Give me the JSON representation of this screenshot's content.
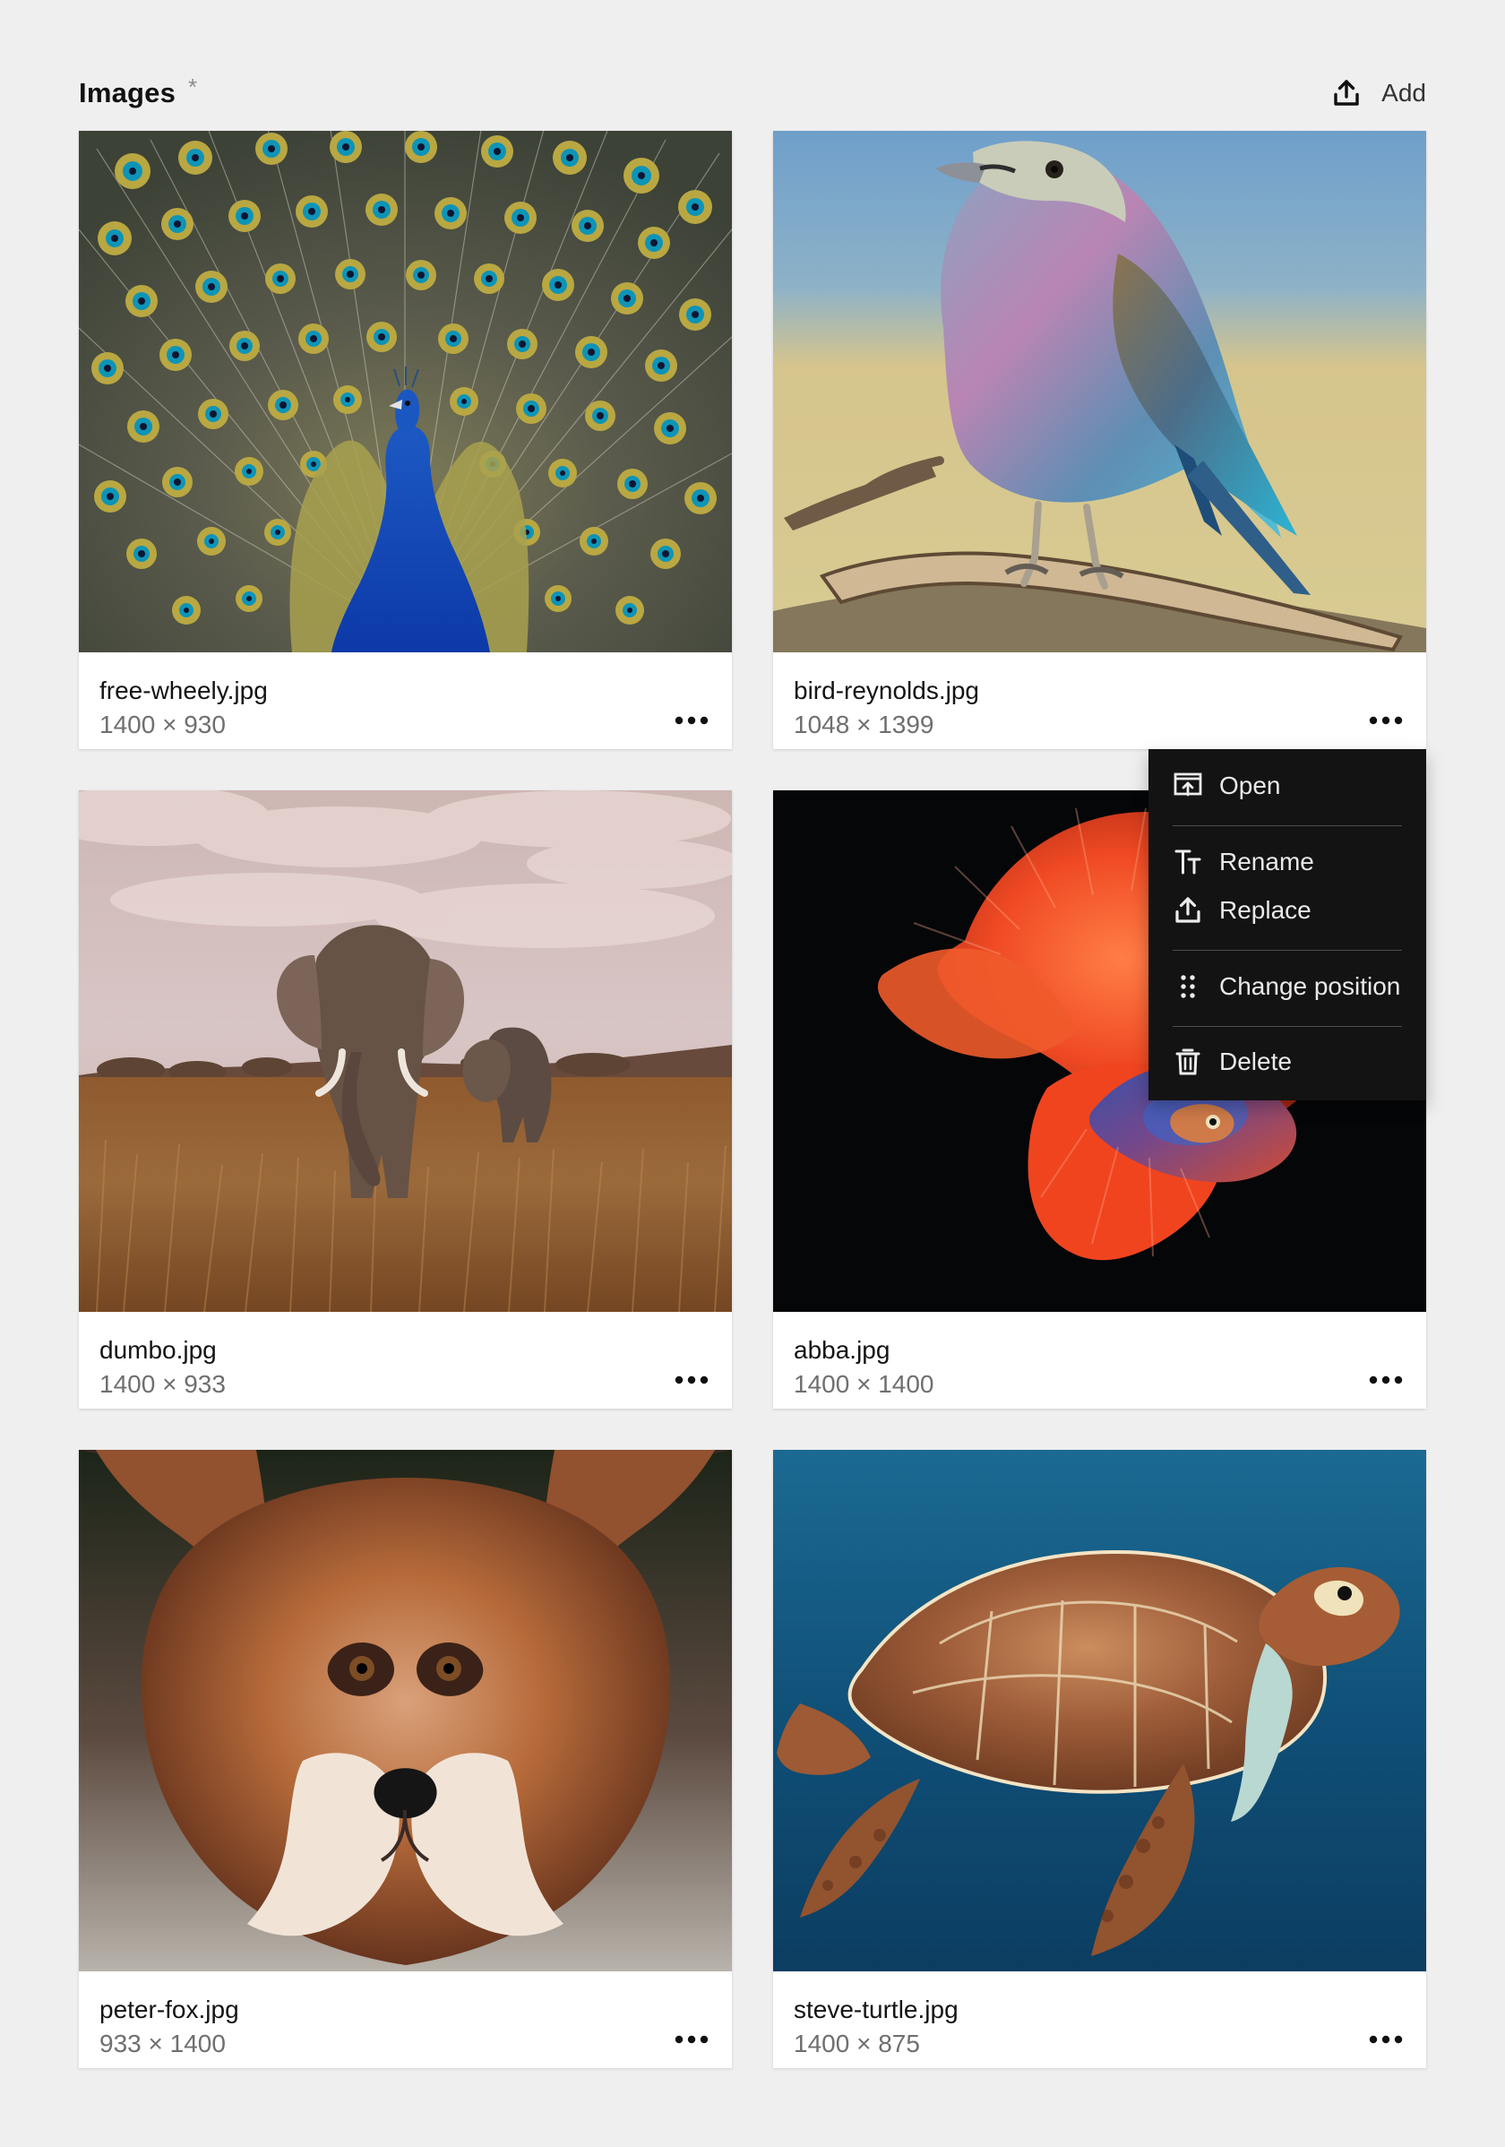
{
  "header": {
    "title": "Images",
    "required_marker": "*",
    "add_label": "Add"
  },
  "images": [
    {
      "filename": "free-wheely.jpg",
      "dimensions": "1400 × 930",
      "subject": "peacock"
    },
    {
      "filename": "bird-reynolds.jpg",
      "dimensions": "1048 × 1399",
      "subject": "lilac-breasted-roller"
    },
    {
      "filename": "dumbo.jpg",
      "dimensions": "1400 × 933",
      "subject": "elephants"
    },
    {
      "filename": "abba.jpg",
      "dimensions": "1400 × 1400",
      "subject": "betta-fish"
    },
    {
      "filename": "peter-fox.jpg",
      "dimensions": "933 × 1400",
      "subject": "fox"
    },
    {
      "filename": "steve-turtle.jpg",
      "dimensions": "1400 × 875",
      "subject": "sea-turtle"
    }
  ],
  "context_menu": {
    "open_label": "Open",
    "rename_label": "Rename",
    "replace_label": "Replace",
    "change_position_label": "Change position",
    "delete_label": "Delete"
  },
  "icons": {
    "upload": "upload-icon",
    "more": "more-icon",
    "open": "open-icon",
    "rename": "rename-icon",
    "replace": "upload-icon",
    "change_position": "drag-handle-icon",
    "delete": "trash-icon"
  },
  "colors": {
    "background": "#efefef",
    "card": "#ffffff",
    "menu": "#131313",
    "muted_text": "#6f6f6f",
    "text": "#141414"
  }
}
